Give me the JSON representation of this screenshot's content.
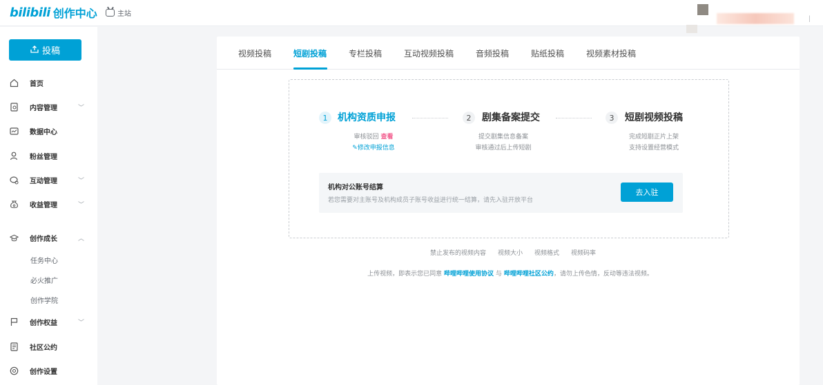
{
  "header": {
    "logo_bili": "bilibili",
    "logo_title": "创作中心",
    "home_label": "主站"
  },
  "sidebar": {
    "upload_label": "投稿",
    "items": [
      {
        "label": "首页",
        "icon": "home-icon",
        "has_chevron": false
      },
      {
        "label": "内容管理",
        "icon": "document-icon",
        "has_chevron": true
      },
      {
        "label": "数据中心",
        "icon": "chart-icon",
        "has_chevron": false
      },
      {
        "label": "粉丝管理",
        "icon": "user-icon",
        "has_chevron": false
      },
      {
        "label": "互动管理",
        "icon": "chat-icon",
        "has_chevron": true
      },
      {
        "label": "收益管理",
        "icon": "money-bag-icon",
        "has_chevron": true
      },
      {
        "label": "创作成长",
        "icon": "graduation-icon",
        "has_chevron": true,
        "expanded": true
      },
      {
        "label": "创作权益",
        "icon": "flag-icon",
        "has_chevron": true
      },
      {
        "label": "社区公约",
        "icon": "rules-icon",
        "has_chevron": false
      },
      {
        "label": "创作设置",
        "icon": "settings-icon",
        "has_chevron": false
      }
    ],
    "growth_sub": [
      "任务中心",
      "必火推广",
      "创作学院"
    ]
  },
  "tabs": [
    "视频投稿",
    "短剧投稿",
    "专栏投稿",
    "互动视频投稿",
    "音频投稿",
    "贴纸投稿",
    "视频素材投稿"
  ],
  "active_tab": "短剧投稿",
  "steps": [
    {
      "num": "1",
      "title": "机构资质申报",
      "desc": "审核驳回",
      "view": "查看",
      "edit": "修改申报信息"
    },
    {
      "num": "2",
      "title": "剧集备案提交",
      "desc1": "提交剧集信息备案",
      "desc2": "审核通过后上传短剧"
    },
    {
      "num": "3",
      "title": "短剧视频投稿",
      "desc1": "完成短剧正片上架",
      "desc2": "支持设置经营模式"
    }
  ],
  "settlement": {
    "title": "机构对公账号结算",
    "desc": "若您需要对主账号及机构成员子账号收益进行统一结算，请先入驻开放平台",
    "button": "去入驻"
  },
  "footer_links": [
    "禁止发布的视频内容",
    "视频大小",
    "视频格式",
    "视频码率"
  ],
  "agreement": {
    "prefix": "上传视频，即表示您已同意",
    "link1": "哔哩哔哩使用协议",
    "and": "与",
    "link2": "哔哩哔哩社区公约",
    "suffix": "，请勿上传色情，反动等违法视频。"
  },
  "colors": {
    "accent": "#00a1d6",
    "pink": "#f25d8e"
  }
}
